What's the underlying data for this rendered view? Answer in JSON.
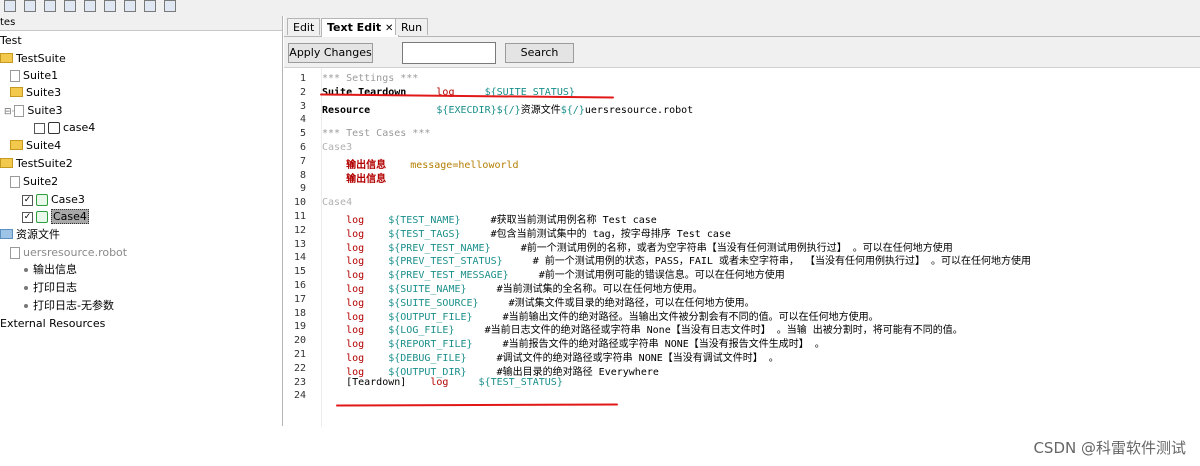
{
  "toolbar": {
    "icons": [
      "new-icon",
      "open-icon",
      "save-icon",
      "save-all-icon",
      "keyword-icon",
      "library-icon",
      "run-icon",
      "bug-icon",
      "stop-icon"
    ]
  },
  "tree": {
    "header": "tes",
    "root": "Test",
    "items": [
      {
        "label": "TestSuite",
        "type": "folder"
      },
      {
        "label": "Suite1",
        "type": "file"
      },
      {
        "label": "Suite3",
        "type": "folder"
      },
      {
        "label": "Suite3",
        "type": "file"
      },
      {
        "label": "case4",
        "type": "case"
      },
      {
        "label": "Suite4",
        "type": "folder"
      },
      {
        "label": "TestSuite2",
        "type": "folder"
      },
      {
        "label": "Suite2",
        "type": "file"
      },
      {
        "label": "Case3",
        "type": "case"
      },
      {
        "label": "Case4",
        "type": "case-selected"
      },
      {
        "label": "资源文件",
        "type": "resource-folder"
      },
      {
        "label": "uersresource.robot",
        "type": "resource-file"
      },
      {
        "label": "输出信息",
        "type": "keyword"
      },
      {
        "label": "打印日志",
        "type": "keyword"
      },
      {
        "label": "打印日志-无参数",
        "type": "keyword"
      },
      {
        "label": "External Resources",
        "type": "external"
      }
    ]
  },
  "tabs": [
    {
      "label": "Edit"
    },
    {
      "label": "Text Edit",
      "active": true,
      "close": "✕"
    },
    {
      "label": "Run"
    }
  ],
  "actions": {
    "apply_label": "Apply Changes",
    "search_label": "Search",
    "search_value": ""
  },
  "editor": {
    "lines": [
      {
        "n": "1",
        "segments": [
          {
            "t": "*** Settings ***",
            "c": "comment"
          }
        ]
      },
      {
        "n": "2",
        "segments": [
          {
            "t": "Suite Teardown",
            "c": "strong"
          },
          {
            "t": "     "
          },
          {
            "t": "log",
            "c": "kw-red"
          },
          {
            "t": "     "
          },
          {
            "t": "${SUITE_STATUS}",
            "c": "var"
          }
        ]
      },
      {
        "n": "3",
        "segments": [
          {
            "t": "Resource",
            "c": "strong"
          },
          {
            "t": "           "
          },
          {
            "t": "${EXECDIR}",
            "c": "var"
          },
          {
            "t": "${/}",
            "c": "var"
          },
          {
            "t": "资源文件"
          },
          {
            "t": "${/}",
            "c": "var"
          },
          {
            "t": "uersresource.robot"
          }
        ]
      },
      {
        "n": "4",
        "segments": []
      },
      {
        "n": "5",
        "segments": [
          {
            "t": "*** Test Cases ***",
            "c": "comment"
          }
        ]
      },
      {
        "n": "6",
        "segments": [
          {
            "t": "Case3",
            "c": "case"
          }
        ]
      },
      {
        "n": "7",
        "segments": [
          {
            "t": "    "
          },
          {
            "t": "输出信息",
            "c": "kw-bold-red"
          },
          {
            "t": "    "
          },
          {
            "t": "message=helloworld",
            "c": "arg"
          }
        ]
      },
      {
        "n": "8",
        "segments": [
          {
            "t": "    "
          },
          {
            "t": "输出信息",
            "c": "kw-bold-red"
          }
        ]
      },
      {
        "n": "9",
        "segments": []
      },
      {
        "n": "10",
        "segments": [
          {
            "t": "Case4",
            "c": "case"
          }
        ]
      },
      {
        "n": "11",
        "segments": [
          {
            "t": "    "
          },
          {
            "t": "log",
            "c": "kw-red"
          },
          {
            "t": "    "
          },
          {
            "t": "${TEST_NAME}",
            "c": "var"
          },
          {
            "t": "     #获取当前测试用例名称 Test case"
          }
        ]
      },
      {
        "n": "12",
        "segments": [
          {
            "t": "    "
          },
          {
            "t": "log",
            "c": "kw-red"
          },
          {
            "t": "    "
          },
          {
            "t": "${TEST_TAGS}",
            "c": "var"
          },
          {
            "t": "     #包含当前测试集中的 tag，按字母排序 Test case"
          }
        ]
      },
      {
        "n": "13",
        "segments": [
          {
            "t": "    "
          },
          {
            "t": "log",
            "c": "kw-red"
          },
          {
            "t": "    "
          },
          {
            "t": "${PREV_TEST_NAME}",
            "c": "var"
          },
          {
            "t": "     #前一个测试用例的名称，或者为空字符串【当没有任何测试用例执行过】 。可以在任何地方使用"
          }
        ]
      },
      {
        "n": "14",
        "segments": [
          {
            "t": "    "
          },
          {
            "t": "log",
            "c": "kw-red"
          },
          {
            "t": "    "
          },
          {
            "t": "${PREV_TEST_STATUS}",
            "c": "var"
          },
          {
            "t": "     # 前一个测试用例的状态，PASS，FAIL 或者未空字符串， 【当没有任何用例执行过】 。可以在任何地方使用"
          }
        ]
      },
      {
        "n": "15",
        "segments": [
          {
            "t": "    "
          },
          {
            "t": "log",
            "c": "kw-red"
          },
          {
            "t": "    "
          },
          {
            "t": "${PREV_TEST_MESSAGE}",
            "c": "var"
          },
          {
            "t": "     #前一个测试用例可能的错误信息。可以在任何地方使用"
          }
        ]
      },
      {
        "n": "16",
        "segments": [
          {
            "t": "    "
          },
          {
            "t": "log",
            "c": "kw-red"
          },
          {
            "t": "    "
          },
          {
            "t": "${SUITE_NAME}",
            "c": "var"
          },
          {
            "t": "     #当前测试集的全名称。可以在任何地方使用。"
          }
        ]
      },
      {
        "n": "17",
        "segments": [
          {
            "t": "    "
          },
          {
            "t": "log",
            "c": "kw-red"
          },
          {
            "t": "    "
          },
          {
            "t": "${SUITE_SOURCE}",
            "c": "var"
          },
          {
            "t": "     #测试集文件或目录的绝对路径，可以在任何地方使用。"
          }
        ]
      },
      {
        "n": "18",
        "segments": [
          {
            "t": "    "
          },
          {
            "t": "log",
            "c": "kw-red"
          },
          {
            "t": "    "
          },
          {
            "t": "${OUTPUT_FILE}",
            "c": "var"
          },
          {
            "t": "     #当前输出文件的绝对路径。当输出文件被分割会有不同的值。可以在任何地方使用。"
          }
        ]
      },
      {
        "n": "19",
        "segments": [
          {
            "t": "    "
          },
          {
            "t": "log",
            "c": "kw-red"
          },
          {
            "t": "    "
          },
          {
            "t": "${LOG_FILE}",
            "c": "var"
          },
          {
            "t": "     #当前日志文件的绝对路径或字符串 None【当没有日志文件时】 。当输 出被分割时，将可能有不同的值。"
          }
        ]
      },
      {
        "n": "20",
        "segments": [
          {
            "t": "    "
          },
          {
            "t": "log",
            "c": "kw-red"
          },
          {
            "t": "    "
          },
          {
            "t": "${REPORT_FILE}",
            "c": "var"
          },
          {
            "t": "     #当前报告文件的绝对路径或字符串 NONE【当没有报告文件生成时】 。"
          }
        ]
      },
      {
        "n": "21",
        "segments": [
          {
            "t": "    "
          },
          {
            "t": "log",
            "c": "kw-red"
          },
          {
            "t": "    "
          },
          {
            "t": "${DEBUG_FILE}",
            "c": "var"
          },
          {
            "t": "     #调试文件的绝对路径或字符串 NONE【当没有调试文件时】 。"
          }
        ]
      },
      {
        "n": "22",
        "segments": [
          {
            "t": "    "
          },
          {
            "t": "log",
            "c": "kw-red"
          },
          {
            "t": "    "
          },
          {
            "t": "${OUTPUT_DIR}",
            "c": "var"
          },
          {
            "t": "     #输出目录的绝对路径 Everywhere"
          }
        ]
      },
      {
        "n": "23",
        "segments": [
          {
            "t": "    [Teardown]    "
          },
          {
            "t": "log",
            "c": "kw-red"
          },
          {
            "t": "     "
          },
          {
            "t": "${TEST_STATUS}",
            "c": "var"
          }
        ]
      },
      {
        "n": "24",
        "segments": []
      }
    ]
  },
  "annotations": {
    "underline_color": "#e21818"
  },
  "watermark": "CSDN @科雷软件测试"
}
